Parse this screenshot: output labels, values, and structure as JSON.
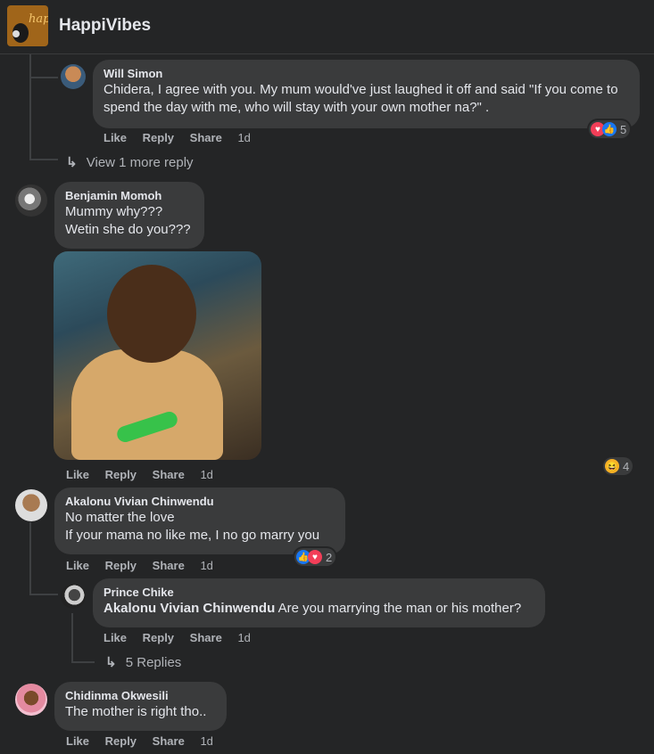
{
  "page": {
    "name": "HappiVibes",
    "avatar_text": "hap"
  },
  "comments": {
    "will": {
      "author": "Will Simon",
      "text": "Chidera, I agree with you. My mum would've just laughed it off and said \"If you come to spend the day with me, who will stay with your own mother na?\" .",
      "actions": {
        "like": "Like",
        "reply": "Reply",
        "share": "Share",
        "time": "1d"
      },
      "reactions": {
        "icons": [
          "heart-icon",
          "like-icon"
        ],
        "count": "5"
      }
    },
    "view_more": "View 1 more reply",
    "benjamin": {
      "author": "Benjamin Momoh",
      "text": "Mummy why???\nWetin she do you???",
      "actions": {
        "like": "Like",
        "reply": "Reply",
        "share": "Share",
        "time": "1d"
      },
      "reactions": {
        "icons": [
          "haha-icon"
        ],
        "count": "4"
      }
    },
    "akalonu": {
      "author": "Akalonu Vivian Chinwendu",
      "text": "No matter the love\nIf your mama no like me, I no go marry you",
      "actions": {
        "like": "Like",
        "reply": "Reply",
        "share": "Share",
        "time": "1d"
      },
      "reactions": {
        "icons": [
          "like-icon",
          "heart-icon"
        ],
        "count": "2"
      }
    },
    "prince": {
      "author": "Prince Chike",
      "mention": "Akalonu Vivian Chinwendu",
      "text": " Are you marrying the man or his mother?",
      "actions": {
        "like": "Like",
        "reply": "Reply",
        "share": "Share",
        "time": "1d"
      }
    },
    "replies_link": "5 Replies",
    "chidinma": {
      "author": "Chidinma Okwesili",
      "text": "The mother is right tho..",
      "actions": {
        "like": "Like",
        "reply": "Reply",
        "share": "Share",
        "time": "1d"
      }
    }
  },
  "colors": {
    "background": "#242526",
    "bubble": "#3a3b3c",
    "text": "#e4e6eb",
    "muted": "#b0b3b8"
  }
}
